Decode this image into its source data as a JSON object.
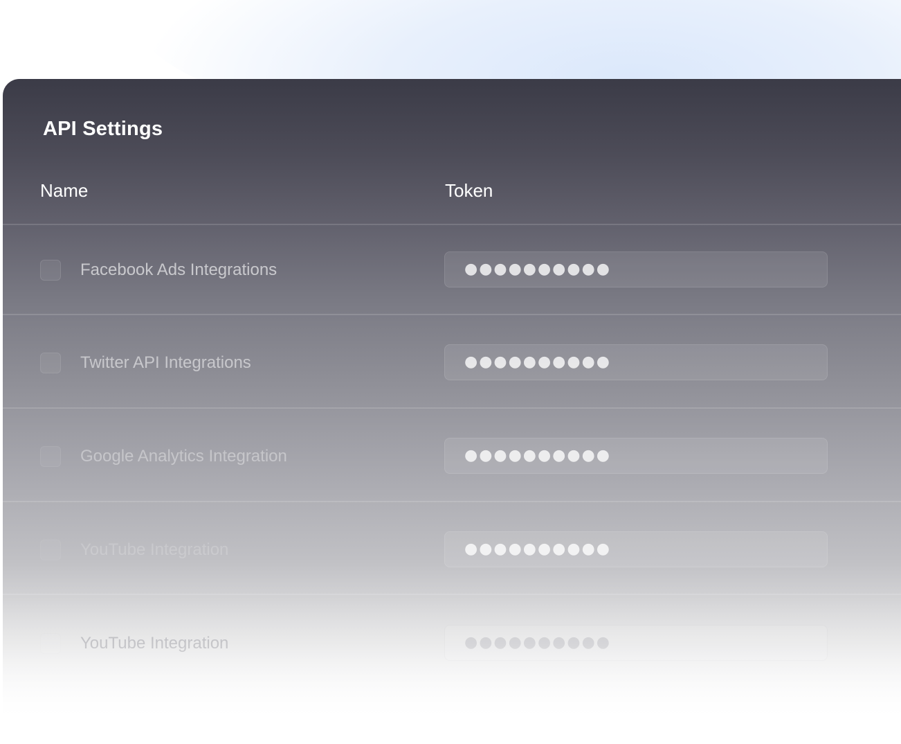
{
  "panel": {
    "title": "API Settings"
  },
  "table": {
    "columns": {
      "name": "Name",
      "token": "Token"
    },
    "rows": [
      {
        "name": "Facebook Ads Integrations",
        "token_masked": "●●●●●●●●●●",
        "checked": false
      },
      {
        "name": "Twitter API Integrations",
        "token_masked": "●●●●●●●●●●",
        "checked": false
      },
      {
        "name": "Google Analytics Integration",
        "token_masked": "●●●●●●●●●●",
        "checked": false
      },
      {
        "name": "YouTube Integration",
        "token_masked": "●●●●●●●●●●",
        "checked": false
      },
      {
        "name": "YouTube Integration",
        "token_masked": "●●●●●●●●●●",
        "checked": false
      }
    ]
  },
  "colors": {
    "panel_top": "#3b3b47",
    "panel_bottom": "#ffffff",
    "glow": "#dbe8fb"
  }
}
